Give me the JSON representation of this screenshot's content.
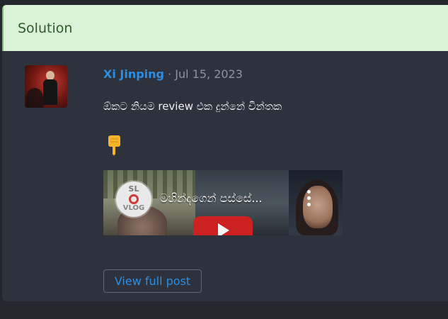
{
  "header": {
    "title": "Solution"
  },
  "post": {
    "author": "Xi Jinping",
    "separator": " · ",
    "date": "Jul 15, 2023",
    "text": "ඕකට නියම review එක දුන්නේ චින්තක",
    "emoji": "👇",
    "video": {
      "title": "මහින්දගෙන් පස්සේ...",
      "channel_logo_top": "SL",
      "channel_logo_bottom": "VLOG"
    }
  },
  "actions": {
    "view_full_post": "View full post"
  },
  "colors": {
    "header_bg": "#d9f1d6",
    "header_text": "#2f5d2a",
    "card_bg": "#2e323d",
    "accent": "#2d8de0",
    "play_button": "#d52020"
  }
}
